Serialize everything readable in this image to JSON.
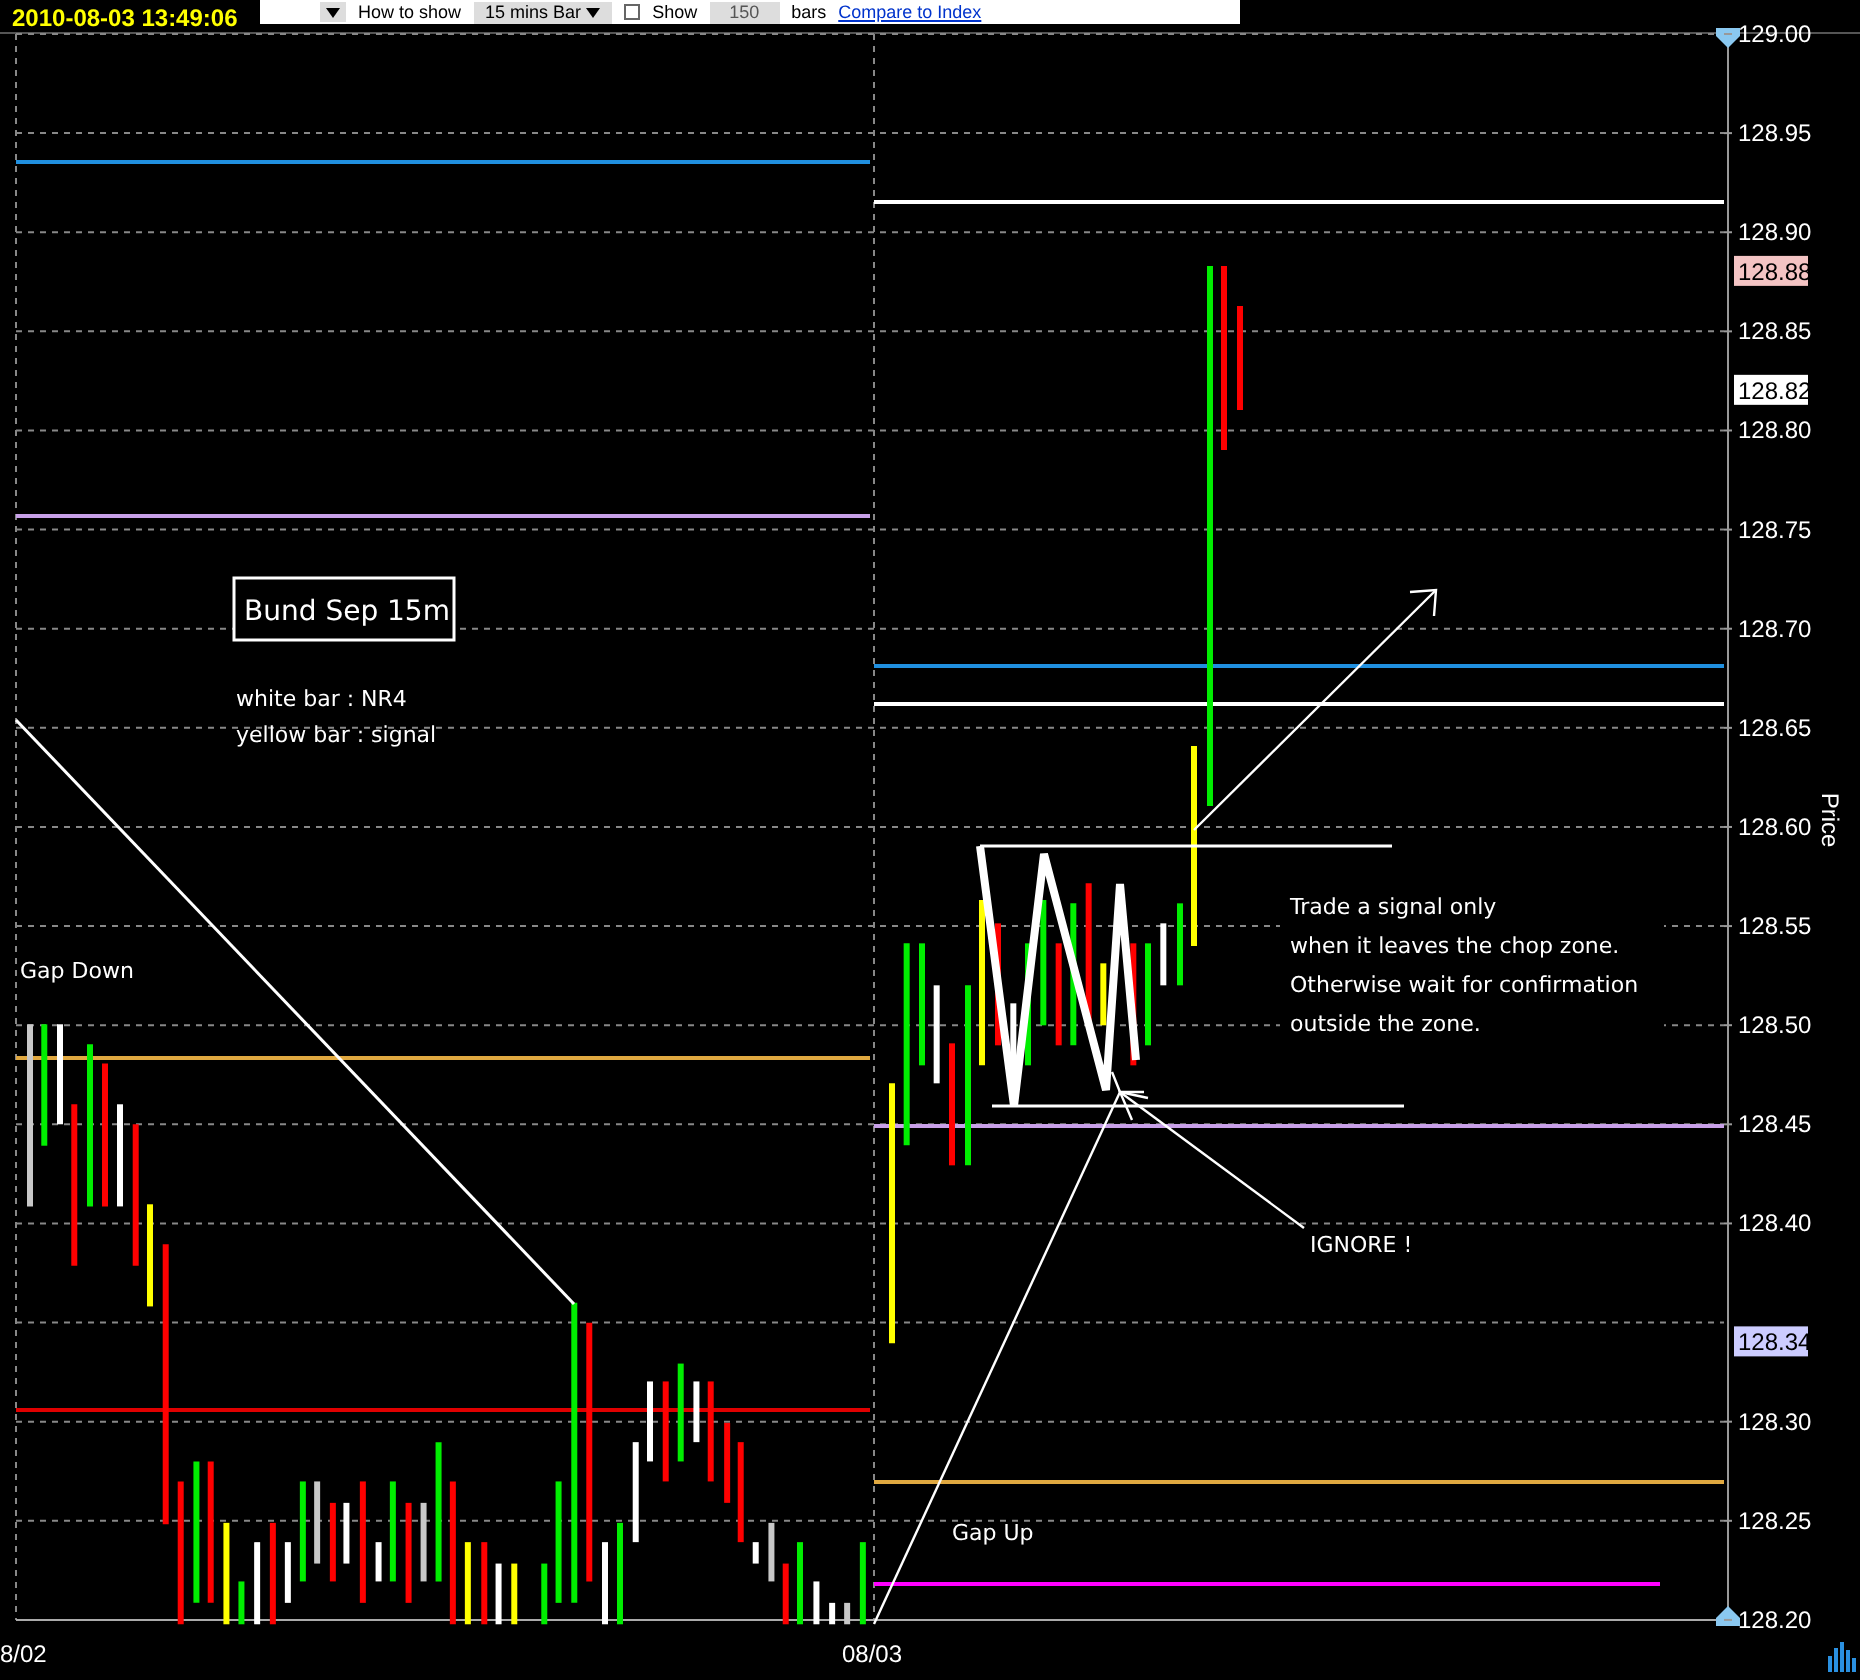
{
  "timestamp": "2010-08-03 13:49:06",
  "toolbar": {
    "label": "How to show",
    "interval": "15 mins Bar",
    "show_label": "Show",
    "show_checked": false,
    "bar_count": "150",
    "bars_label": "bars",
    "link": "Compare to Index"
  },
  "chart": {
    "ylabel": "Price",
    "yticks": [
      "129.00",
      "128.95",
      "128.90",
      "128.85",
      "128.80",
      "128.75",
      "128.70",
      "128.65",
      "128.60",
      "128.55",
      "128.50",
      "128.45",
      "128.40",
      "128.30",
      "128.25",
      "128.20"
    ],
    "xlabels": [
      "8/02",
      "08/03"
    ],
    "price_tags": [
      {
        "text": "128.88",
        "color": "#f4c4c4"
      },
      {
        "text": "128.82",
        "color": "#ffffff"
      },
      {
        "text": "128.34",
        "color": "#ccccff"
      }
    ]
  },
  "notes": [
    {
      "kind": "box",
      "text": "Bund Sep 15m"
    },
    {
      "kind": "legend",
      "text": "white bar : NR4"
    },
    {
      "kind": "legend",
      "text": "yellow bar : signal"
    },
    {
      "kind": "label",
      "text": "Gap Down"
    },
    {
      "kind": "label",
      "text": "Gap Up"
    },
    {
      "kind": "label",
      "text": "IGNORE !"
    },
    {
      "kind": "paragraph",
      "lines": [
        "Trade a signal only",
        "when it leaves the chop zone.",
        "Otherwise wait for confirmation",
        "outside the zone."
      ]
    }
  ]
}
